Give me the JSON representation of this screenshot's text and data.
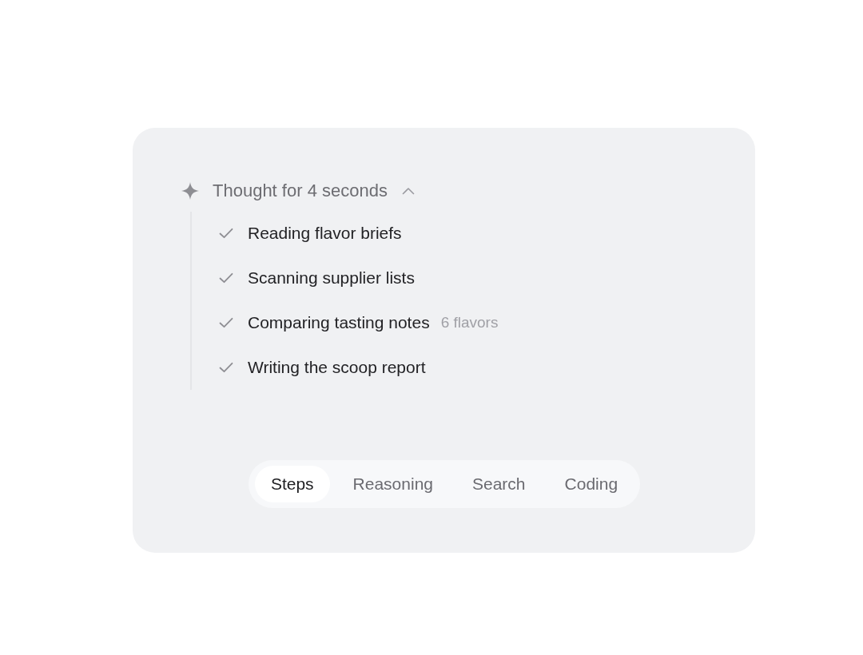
{
  "header": {
    "label": "Thought for 4 seconds",
    "expanded": true
  },
  "steps": [
    {
      "label": "Reading flavor briefs",
      "done": true
    },
    {
      "label": "Scanning supplier lists",
      "done": true
    },
    {
      "label": "Comparing tasting notes",
      "detail": "6 flavors",
      "done": true
    },
    {
      "label": "Writing the scoop report",
      "done": true
    }
  ],
  "tabs": [
    {
      "label": "Steps",
      "selected": true
    },
    {
      "label": "Reasoning",
      "selected": false
    },
    {
      "label": "Search",
      "selected": false
    },
    {
      "label": "Coding",
      "selected": false
    }
  ]
}
